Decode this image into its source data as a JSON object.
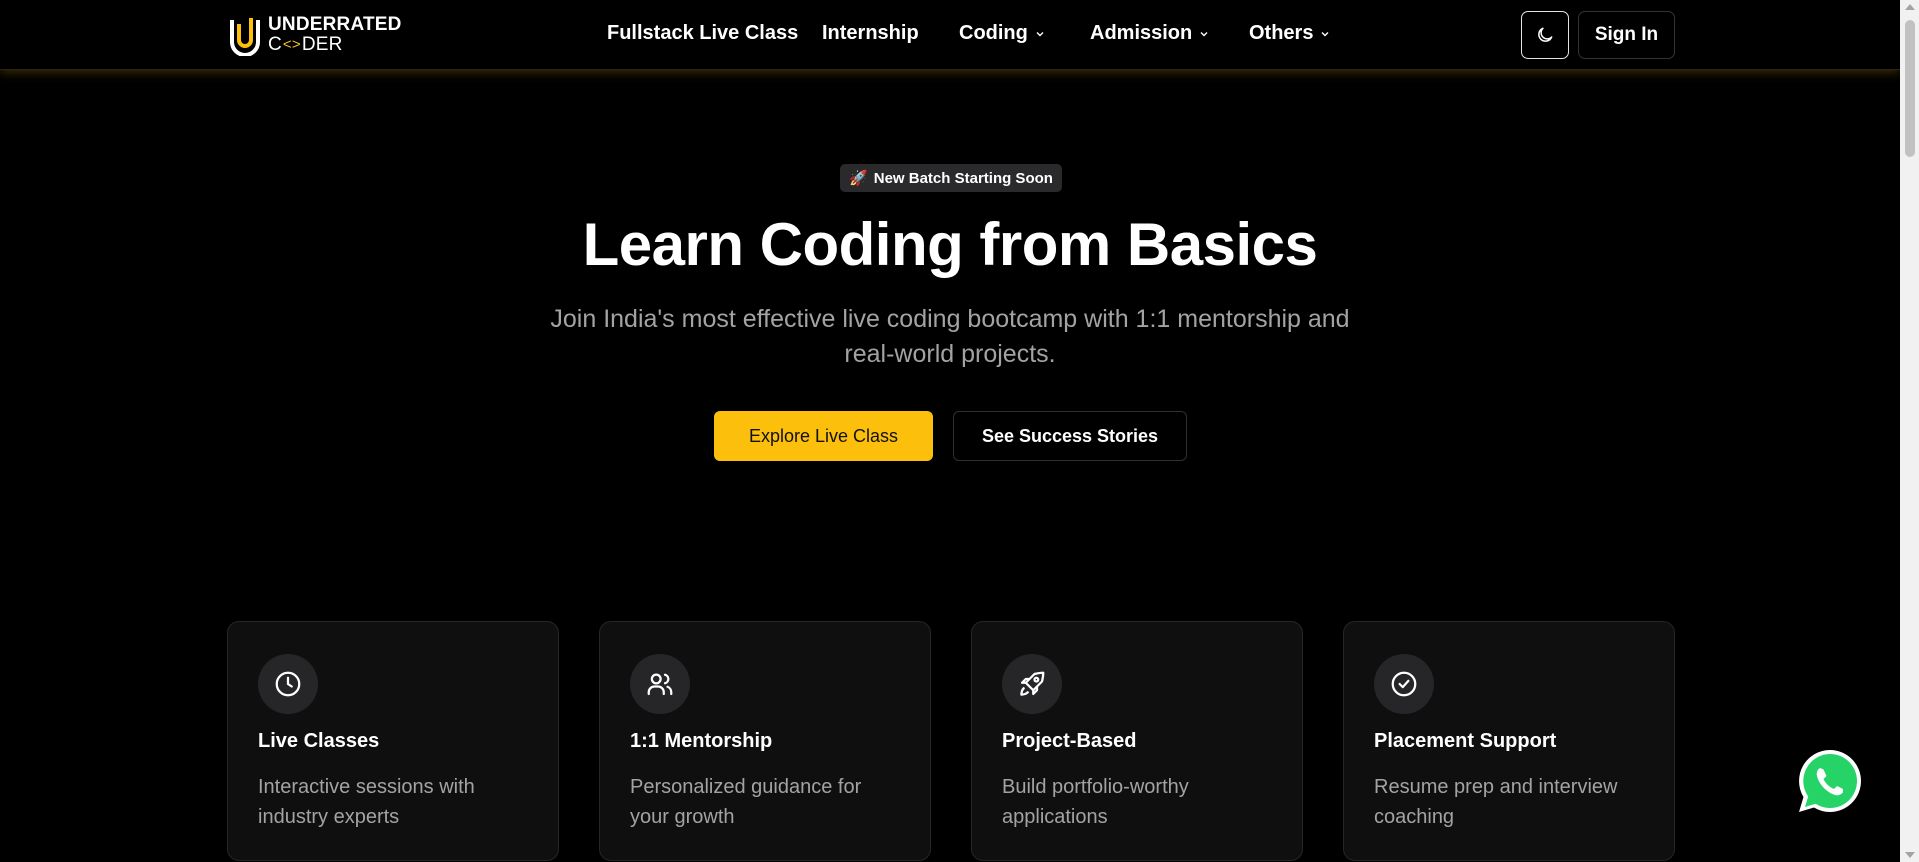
{
  "brand": {
    "line1": "UNDERRATED",
    "line2_prefix": "C",
    "line2_code": "<>",
    "line2_suffix": "DER",
    "accent": "#fbbf0c"
  },
  "nav": {
    "items": [
      {
        "label": "Fullstack Live Class",
        "dropdown": false
      },
      {
        "label": "Internship",
        "dropdown": false
      },
      {
        "label": "Coding",
        "dropdown": true
      },
      {
        "label": "Admission",
        "dropdown": true
      },
      {
        "label": "Others",
        "dropdown": true
      }
    ],
    "theme_icon": "moon-icon",
    "signin_label": "Sign In"
  },
  "hero": {
    "badge_icon": "🚀",
    "badge_text": "New Batch Starting Soon",
    "title": "Learn Coding from Basics",
    "subtitle": "Join India's most effective live coding bootcamp with 1:1 mentorship and real-world projects.",
    "primary_cta": "Explore Live Class",
    "secondary_cta": "See Success Stories"
  },
  "features": [
    {
      "icon": "clock-icon",
      "title": "Live Classes",
      "description": "Interactive sessions with industry experts"
    },
    {
      "icon": "users-icon",
      "title": "1:1 Mentorship",
      "description": "Personalized guidance for your growth"
    },
    {
      "icon": "rocket-icon",
      "title": "Project-Based",
      "description": "Build portfolio-worthy applications"
    },
    {
      "icon": "check-circle-icon",
      "title": "Placement Support",
      "description": "Resume prep and interview coaching"
    }
  ],
  "floating": {
    "icon": "whatsapp-icon"
  }
}
